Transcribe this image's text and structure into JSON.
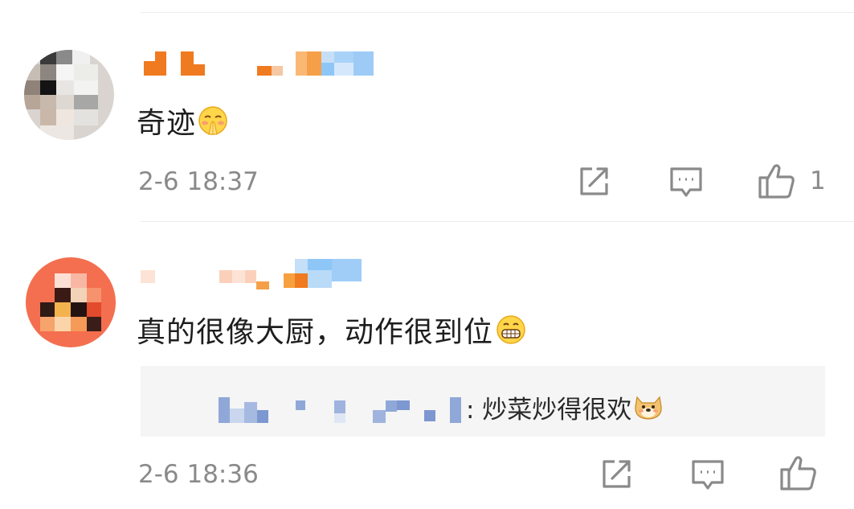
{
  "comments": [
    {
      "text": "奇迹",
      "emoji": "praying-hands-face-emoji",
      "timestamp": "2-6 18:37",
      "like_count": "1"
    },
    {
      "text": "真的很像大厨，动作很到位",
      "emoji": "grinning-face-emoji",
      "timestamp": "2-6 18:36",
      "reply": {
        "text": "‌: 炒菜炒得很欢",
        "emoji": "doge-emoji"
      }
    }
  ],
  "colors": {
    "username_orange": "#f07a1f",
    "username_blue": "#8ec6f7",
    "timestamp_gray": "#8a8a8a",
    "icon_gray": "#888888"
  },
  "icons": [
    "share-icon",
    "comment-icon",
    "thumbs-up-icon"
  ]
}
